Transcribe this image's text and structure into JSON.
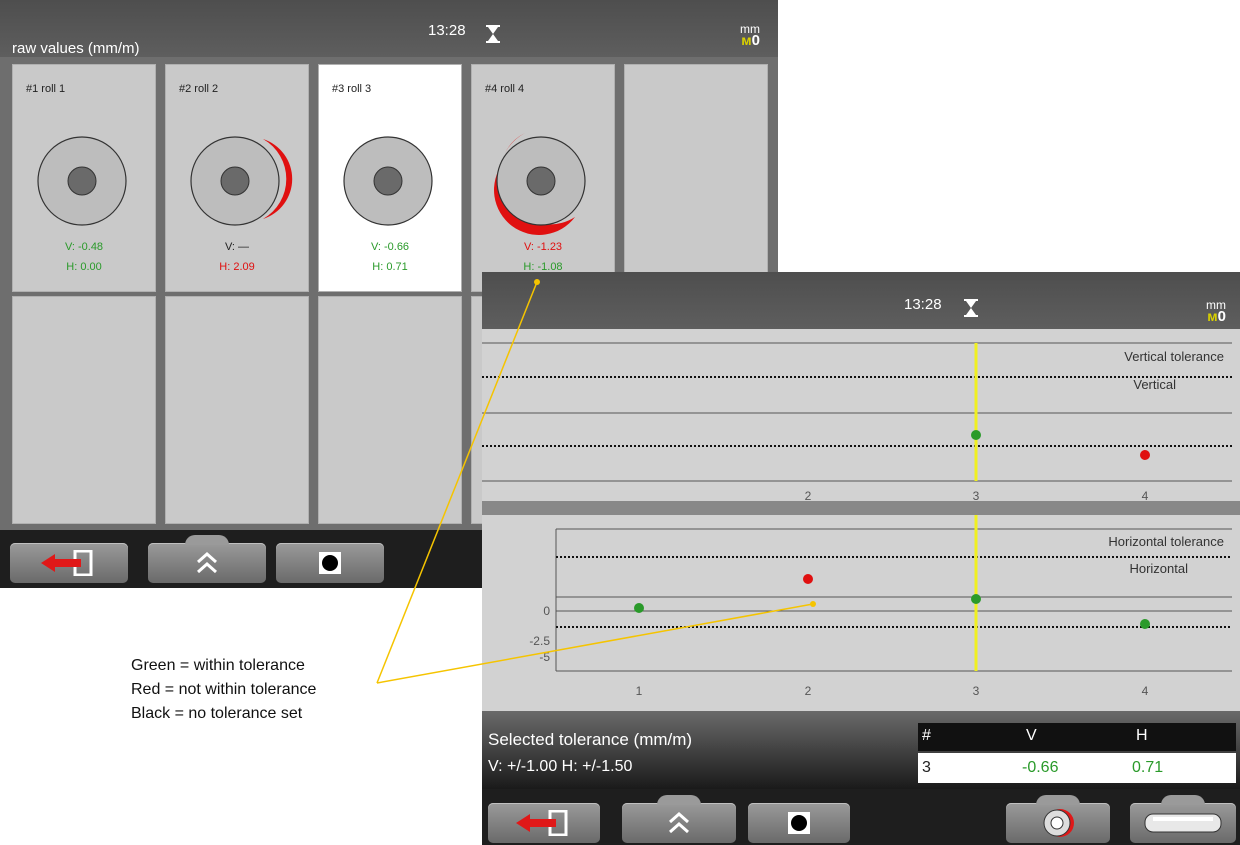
{
  "screen1": {
    "time": "13:28",
    "unit": "mm",
    "unit_value": "0",
    "title": "raw values (mm/m)",
    "rolls": [
      {
        "label": "#1 roll 1",
        "v": "V: -0.48",
        "v_status": "green",
        "h": "H: 0.00",
        "h_status": "green"
      },
      {
        "label": "#2 roll 2",
        "v": "V: —",
        "v_status": "black",
        "h": "H: 2.09",
        "h_status": "red"
      },
      {
        "label": "#3 roll 3",
        "v": "V: -0.66",
        "v_status": "green",
        "h": "H: 0.71",
        "h_status": "green"
      },
      {
        "label": "#4 roll 4",
        "v": "V: -1.23",
        "v_status": "red",
        "h": "H: -1.08",
        "h_status": "green"
      }
    ],
    "selected_roll": 3
  },
  "screen2": {
    "time": "13:28",
    "unit": "mm",
    "unit_value": "0",
    "vertical_plot": {
      "tolerance_label": "Vertical tolerance",
      "series_label": "Vertical",
      "x_ticks": [
        "2",
        "3",
        "4"
      ]
    },
    "horizontal_plot": {
      "tolerance_label": "Horizontal tolerance",
      "series_label": "Horizontal",
      "y_ticks": [
        "0",
        "-2.5",
        "-5"
      ],
      "x_ticks": [
        "1",
        "2",
        "3",
        "4"
      ]
    },
    "selected_tolerance_title": "Selected tolerance (mm/m)",
    "selected_tolerance_values": "V: +/-1.00    H: +/-1.50",
    "table": {
      "headers": [
        "#",
        "V",
        "H"
      ],
      "row": [
        "3",
        "-0.66",
        "0.71"
      ]
    }
  },
  "legend": [
    "Green = within tolerance",
    "Red = not within tolerance",
    "Black = no tolerance set"
  ],
  "colors": {
    "within_tolerance": "#2a9a2a",
    "out_of_tolerance": "#e01010",
    "cursor": "#f0f020",
    "callout_line": "#f5c400"
  },
  "icons": [
    "hourglass-icon",
    "wave-icon",
    "exit-icon",
    "double-chevron-up-icon",
    "record-icon",
    "roll-view-icon",
    "roll-side-icon"
  ]
}
